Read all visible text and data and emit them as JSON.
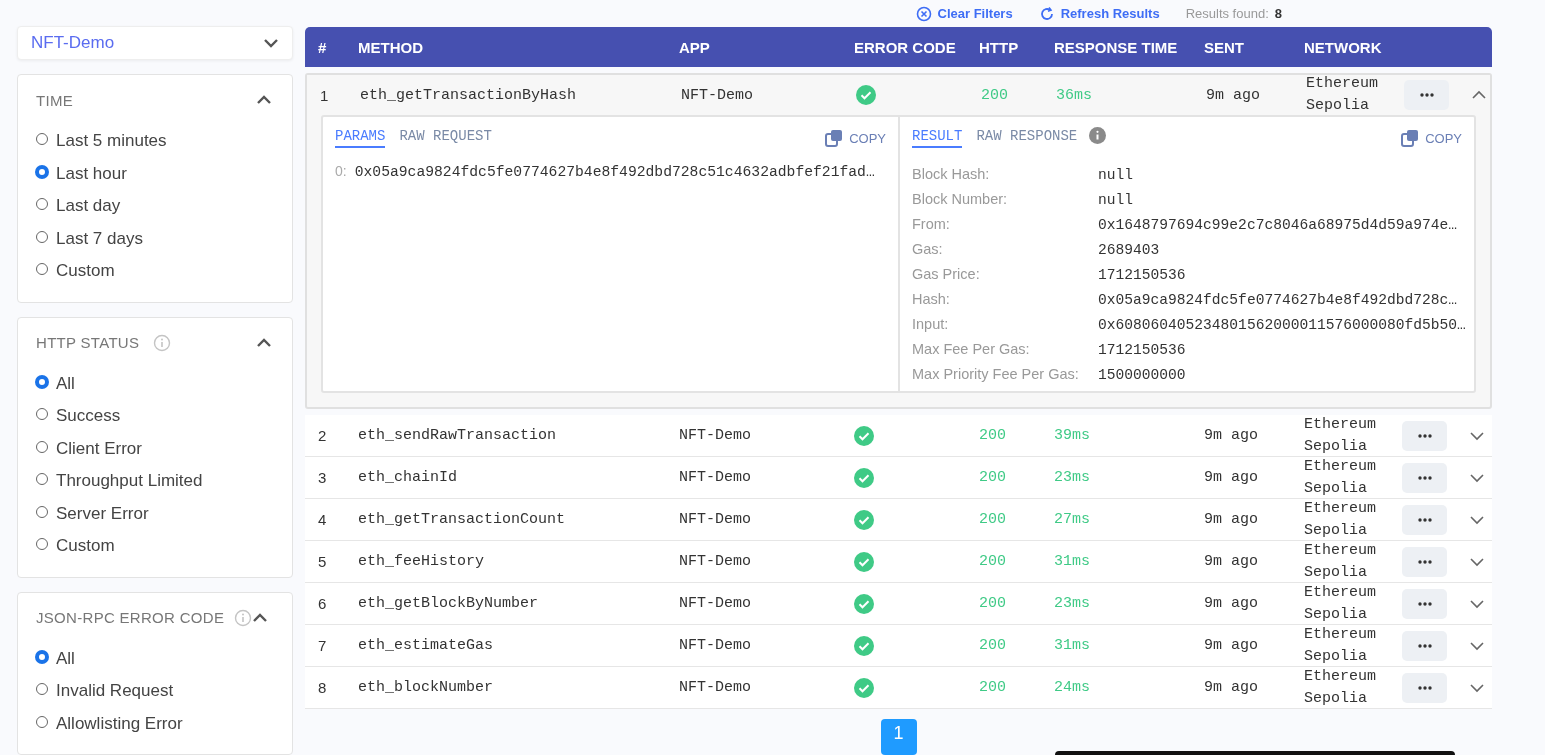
{
  "toolbar": {
    "items": [
      {
        "kind": "clear",
        "label": "Clear Filters"
      },
      {
        "kind": "refresh",
        "label": "Refresh Results"
      },
      {
        "kind": "count",
        "label": "Results found:",
        "value": "8"
      }
    ]
  },
  "sidebar": {
    "app_select": {
      "value": "NFT-Demo"
    },
    "sections": [
      {
        "title": "TIME",
        "info": false,
        "expanded": true,
        "options": [
          {
            "label": "Last 5 minutes",
            "selected": false
          },
          {
            "label": "Last hour",
            "selected": true
          },
          {
            "label": "Last day",
            "selected": false
          },
          {
            "label": "Last 7 days",
            "selected": false
          },
          {
            "label": "Custom",
            "selected": false
          }
        ]
      },
      {
        "title": "HTTP STATUS",
        "info": true,
        "expanded": true,
        "options": [
          {
            "label": "All",
            "selected": true
          },
          {
            "label": "Success",
            "selected": false
          },
          {
            "label": "Client Error",
            "selected": false
          },
          {
            "label": "Throughput Limited",
            "selected": false
          },
          {
            "label": "Server Error",
            "selected": false
          },
          {
            "label": "Custom",
            "selected": false
          }
        ]
      },
      {
        "title": "JSON-RPC ERROR CODE",
        "info": true,
        "expanded": true,
        "options": [
          {
            "label": "All",
            "selected": true
          },
          {
            "label": "Invalid Request",
            "selected": false
          },
          {
            "label": "Allowlisting Error",
            "selected": false
          }
        ]
      }
    ]
  },
  "table": {
    "columns": [
      "#",
      "METHOD",
      "APP",
      "ERROR CODE",
      "HTTP",
      "RESPONSE TIME",
      "SENT",
      "NETWORK"
    ],
    "rows": [
      {
        "num": "1",
        "method": "eth_getTransactionByHash",
        "app": "NFT-Demo",
        "ok": true,
        "http": "200",
        "response_time": "36ms",
        "sent": "9m ago",
        "network": "Ethereum Sepolia",
        "expanded": true
      },
      {
        "num": "2",
        "method": "eth_sendRawTransaction",
        "app": "NFT-Demo",
        "ok": true,
        "http": "200",
        "response_time": "39ms",
        "sent": "9m ago",
        "network": "Ethereum Sepolia",
        "expanded": false
      },
      {
        "num": "3",
        "method": "eth_chainId",
        "app": "NFT-Demo",
        "ok": true,
        "http": "200",
        "response_time": "23ms",
        "sent": "9m ago",
        "network": "Ethereum Sepolia",
        "expanded": false
      },
      {
        "num": "4",
        "method": "eth_getTransactionCount",
        "app": "NFT-Demo",
        "ok": true,
        "http": "200",
        "response_time": "27ms",
        "sent": "9m ago",
        "network": "Ethereum Sepolia",
        "expanded": false
      },
      {
        "num": "5",
        "method": "eth_feeHistory",
        "app": "NFT-Demo",
        "ok": true,
        "http": "200",
        "response_time": "31ms",
        "sent": "9m ago",
        "network": "Ethereum Sepolia",
        "expanded": false
      },
      {
        "num": "6",
        "method": "eth_getBlockByNumber",
        "app": "NFT-Demo",
        "ok": true,
        "http": "200",
        "response_time": "23ms",
        "sent": "9m ago",
        "network": "Ethereum Sepolia",
        "expanded": false
      },
      {
        "num": "7",
        "method": "eth_estimateGas",
        "app": "NFT-Demo",
        "ok": true,
        "http": "200",
        "response_time": "31ms",
        "sent": "9m ago",
        "network": "Ethereum Sepolia",
        "expanded": false
      },
      {
        "num": "8",
        "method": "eth_blockNumber",
        "app": "NFT-Demo",
        "ok": true,
        "http": "200",
        "response_time": "24ms",
        "sent": "9m ago",
        "network": "Ethereum Sepolia",
        "expanded": false
      }
    ],
    "details": {
      "request": {
        "tabs": [
          {
            "label": "PARAMS",
            "selected": true
          },
          {
            "label": "RAW REQUEST",
            "selected": false
          }
        ],
        "copy": "COPY",
        "params": [
          {
            "index": "0:",
            "value": "0x05a9ca9824fdc5fe0774627b4e8f492dbd728c51c4632adbfef21fad…"
          }
        ]
      },
      "response": {
        "tabs": [
          {
            "label": "RESULT",
            "selected": true
          },
          {
            "label": "RAW RESPONSE",
            "selected": false
          }
        ],
        "info": true,
        "copy": "COPY",
        "fields": [
          {
            "label": "Block Hash:",
            "value": "null"
          },
          {
            "label": "Block Number:",
            "value": "null"
          },
          {
            "label": "From:",
            "value": "0x1648797694c99e2c7c8046a68975d4d59a974e…"
          },
          {
            "label": "Gas:",
            "value": "2689403"
          },
          {
            "label": "Gas Price:",
            "value": "1712150536"
          },
          {
            "label": "Hash:",
            "value": "0x05a9ca9824fdc5fe0774627b4e8f492dbd728c…"
          },
          {
            "label": "Input:",
            "value": "0x608060405234801562000011576000080fd5b50…"
          },
          {
            "label": "Max Fee Per Gas:",
            "value": "1712150536"
          },
          {
            "label": "Max Priority Fee Per Gas:",
            "value": "1500000000"
          }
        ]
      }
    }
  },
  "pagination": {
    "pages": [
      {
        "label": "1",
        "selected": true
      }
    ]
  }
}
